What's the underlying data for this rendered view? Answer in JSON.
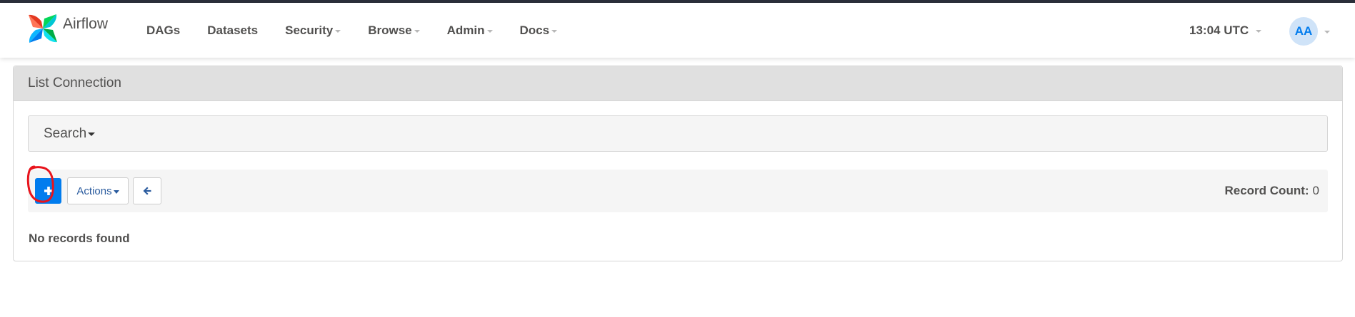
{
  "brand": {
    "name": "Airflow"
  },
  "nav": {
    "items": [
      {
        "label": "DAGs",
        "has_dropdown": false
      },
      {
        "label": "Datasets",
        "has_dropdown": false
      },
      {
        "label": "Security",
        "has_dropdown": true
      },
      {
        "label": "Browse",
        "has_dropdown": true
      },
      {
        "label": "Admin",
        "has_dropdown": true
      },
      {
        "label": "Docs",
        "has_dropdown": true
      }
    ],
    "time": "13:04 UTC",
    "user_initials": "AA"
  },
  "panel": {
    "title": "List Connection",
    "search_label": "Search",
    "toolbar": {
      "add_icon": "plus-icon",
      "actions_label": "Actions",
      "back_icon": "arrow-left-icon",
      "record_count_label": "Record Count:",
      "record_count_value": "0"
    },
    "empty_message": "No records found"
  },
  "colors": {
    "primary": "#017cee",
    "heading_bg": "#e0e0e0",
    "annotation": "#e8141c",
    "text": "#51504f"
  }
}
